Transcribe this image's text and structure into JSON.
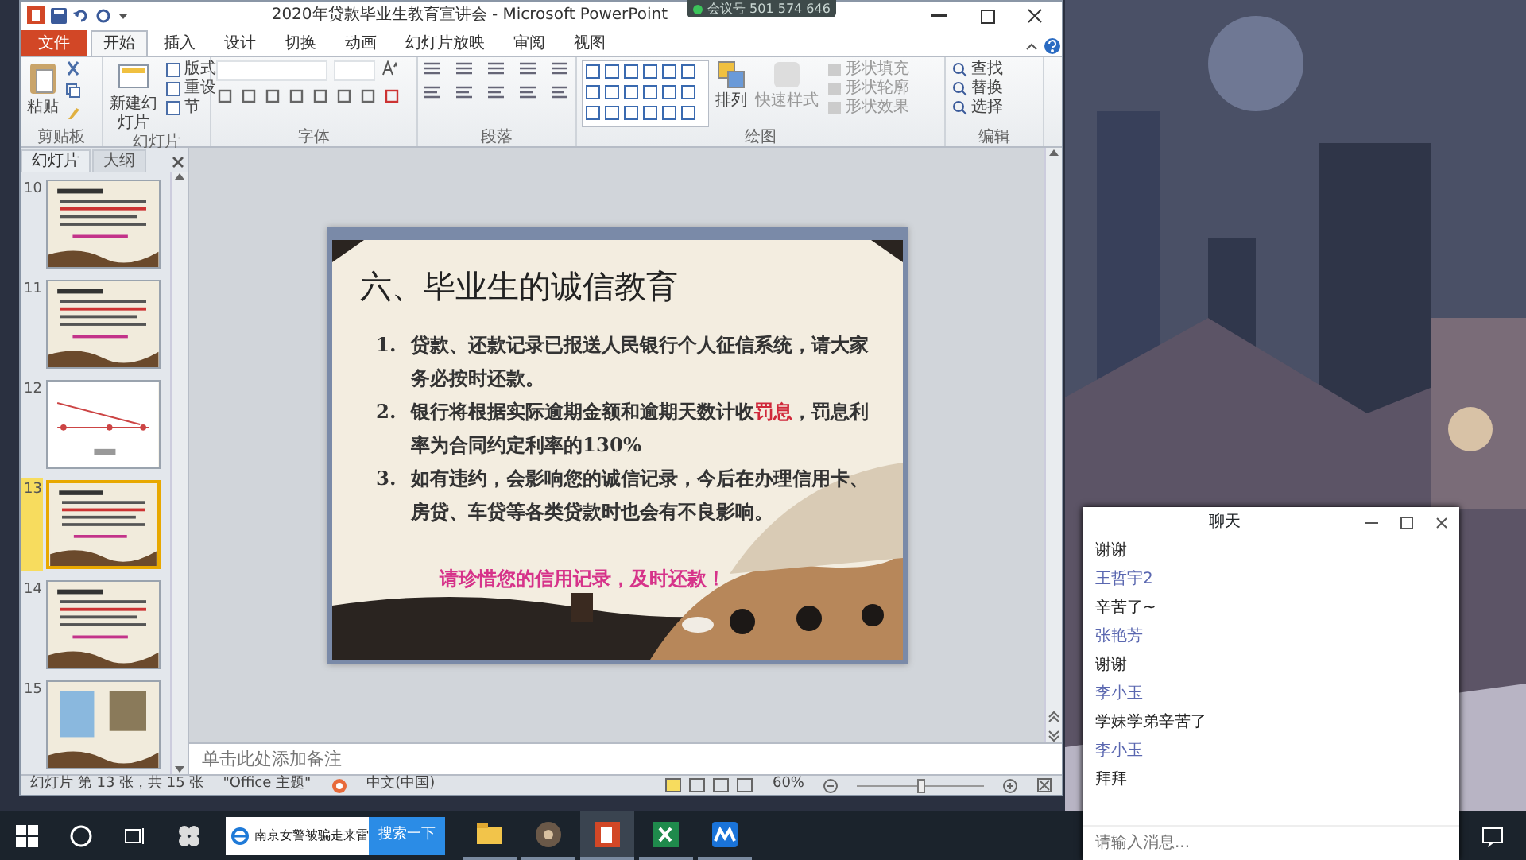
{
  "meeting_badge": "会议号 501 574 646",
  "window": {
    "title": "2020年贷款毕业生教育宣讲会 - Microsoft PowerPoint"
  },
  "tabs": [
    {
      "label": "文件",
      "selected": false,
      "kind": "file"
    },
    {
      "label": "开始",
      "selected": true,
      "kind": "tab"
    },
    {
      "label": "插入",
      "selected": false,
      "kind": "tab"
    },
    {
      "label": "设计",
      "selected": false,
      "kind": "tab"
    },
    {
      "label": "切换",
      "selected": false,
      "kind": "tab"
    },
    {
      "label": "动画",
      "selected": false,
      "kind": "tab"
    },
    {
      "label": "幻灯片放映",
      "selected": false,
      "kind": "tab"
    },
    {
      "label": "审阅",
      "selected": false,
      "kind": "tab"
    },
    {
      "label": "视图",
      "selected": false,
      "kind": "tab"
    }
  ],
  "ribbon": [
    {
      "kind": "clipboard",
      "label": "剪贴板",
      "buttons": [
        "粘贴"
      ]
    },
    {
      "kind": "slides",
      "label": "幻灯片",
      "buttons": [
        "新建幻灯片",
        "版式",
        "重设",
        "节"
      ]
    },
    {
      "kind": "font",
      "label": "字体"
    },
    {
      "kind": "paragraph",
      "label": "段落"
    },
    {
      "kind": "drawing",
      "label": "绘图",
      "buttons": [
        "排列",
        "快速样式",
        "形状填充",
        "形状轮廓",
        "形状效果"
      ]
    },
    {
      "kind": "editing",
      "label": "编辑",
      "buttons": [
        "查找",
        "替换",
        "选择"
      ]
    }
  ],
  "pane_tabs": [
    {
      "label": "幻灯片",
      "selected": true
    },
    {
      "label": "大纲",
      "selected": false
    }
  ],
  "thumbnails": [
    {
      "number": "10",
      "selected": false,
      "kind": "text"
    },
    {
      "number": "11",
      "selected": false,
      "kind": "text"
    },
    {
      "number": "12",
      "selected": false,
      "kind": "chart"
    },
    {
      "number": "13",
      "selected": true,
      "kind": "text"
    },
    {
      "number": "14",
      "selected": false,
      "kind": "text"
    },
    {
      "number": "15",
      "selected": false,
      "kind": "images"
    }
  ],
  "slide": {
    "title": "六、毕业生的诚信教育",
    "items": [
      {
        "number": "1.",
        "parts": [
          {
            "text": "贷款、还款记录已报送人民银行个人征信系统，请大家务必按时还款。",
            "highlight": false
          }
        ]
      },
      {
        "number": "2.",
        "parts": [
          {
            "text": "银行将根据实际逾期金额和逾期天数计收",
            "highlight": false
          },
          {
            "text": "罚息",
            "highlight": true
          },
          {
            "text": "，罚息利率为合同约定利率的130%",
            "highlight": false
          }
        ]
      },
      {
        "number": "3.",
        "parts": [
          {
            "text": "如有违约，会影响您的诚信记录，今后在办理信用卡、房贷、车贷等各类贷款时也会有不良影响。",
            "highlight": false
          }
        ]
      }
    ],
    "footer": "请珍惜您的信用记录，及时还款！"
  },
  "notes": {
    "placeholder": "单击此处添加备注"
  },
  "status_bar": {
    "slide_info": "幻灯片 第 13 张，共 15 张",
    "theme": "\"Office 主题\"",
    "language": "中文(中国)",
    "zoom": "60%",
    "level": 0.5
  },
  "chat": {
    "title": "聊天",
    "messages": [
      {
        "kind": "text",
        "text": "谢谢"
      },
      {
        "kind": "name",
        "text": "王哲宇2"
      },
      {
        "kind": "text",
        "text": "辛苦了~"
      },
      {
        "kind": "name",
        "text": "张艳芳"
      },
      {
        "kind": "text",
        "text": "谢谢"
      },
      {
        "kind": "name",
        "text": "李小玉"
      },
      {
        "kind": "text",
        "text": "学妹学弟辛苦了"
      },
      {
        "kind": "name",
        "text": "李小玉"
      },
      {
        "kind": "text",
        "text": "拜拜"
      }
    ],
    "input": {
      "placeholder": "请输入消息..."
    }
  },
  "taskbar": {
    "search": {
      "value": "南京女警被骗走来雷"
    },
    "search_button": "搜索一下",
    "apps": [
      {
        "kind": "explorer",
        "selected": false
      },
      {
        "kind": "media",
        "selected": false
      },
      {
        "kind": "powerpoint",
        "selected": true
      },
      {
        "kind": "excel",
        "selected": false
      },
      {
        "kind": "meeting",
        "selected": false
      }
    ]
  }
}
